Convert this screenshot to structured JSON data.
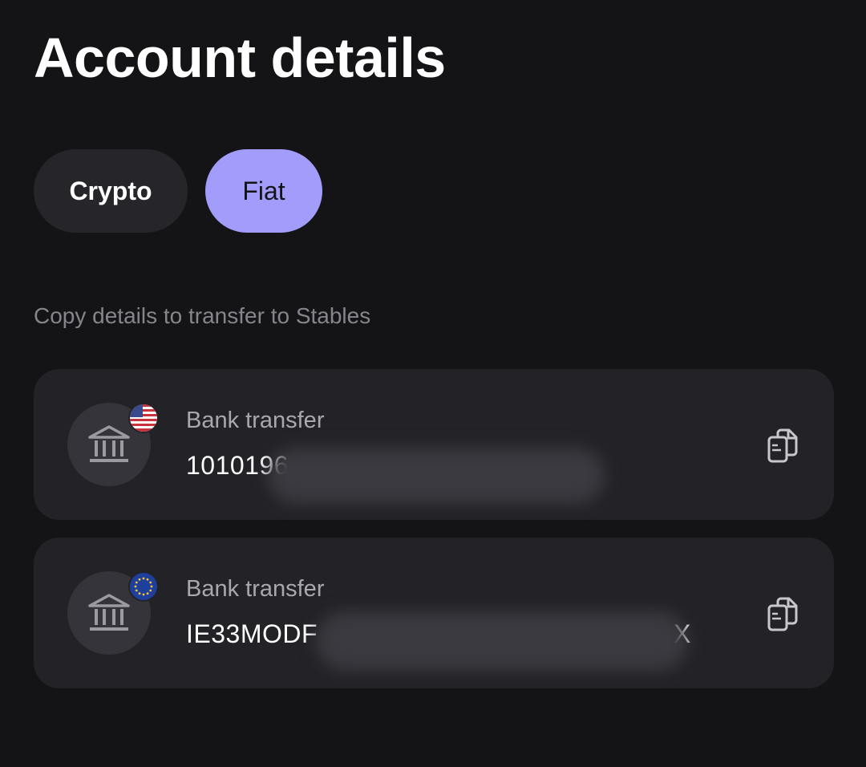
{
  "header": {
    "title": "Account details"
  },
  "tabs": [
    {
      "label": "Crypto",
      "selected": false
    },
    {
      "label": "Fiat",
      "selected": true
    }
  ],
  "subtitle": "Copy details to transfer to Stables",
  "accounts": [
    {
      "label": "Bank transfer",
      "value_visible": "1010196",
      "value_redacted": true,
      "flag_icon": "us-flag-icon",
      "bank_icon": "bank-icon",
      "copy_icon": "copy-icon"
    },
    {
      "label": "Bank transfer",
      "value_visible": "IE33MODF",
      "value_suffix": "X",
      "value_redacted": true,
      "flag_icon": "eu-flag-icon",
      "bank_icon": "bank-icon",
      "copy_icon": "copy-icon"
    }
  ],
  "colors": {
    "background": "#141417",
    "card": "#222227",
    "accent": "#a29dfb",
    "muted_text": "#85858c"
  }
}
